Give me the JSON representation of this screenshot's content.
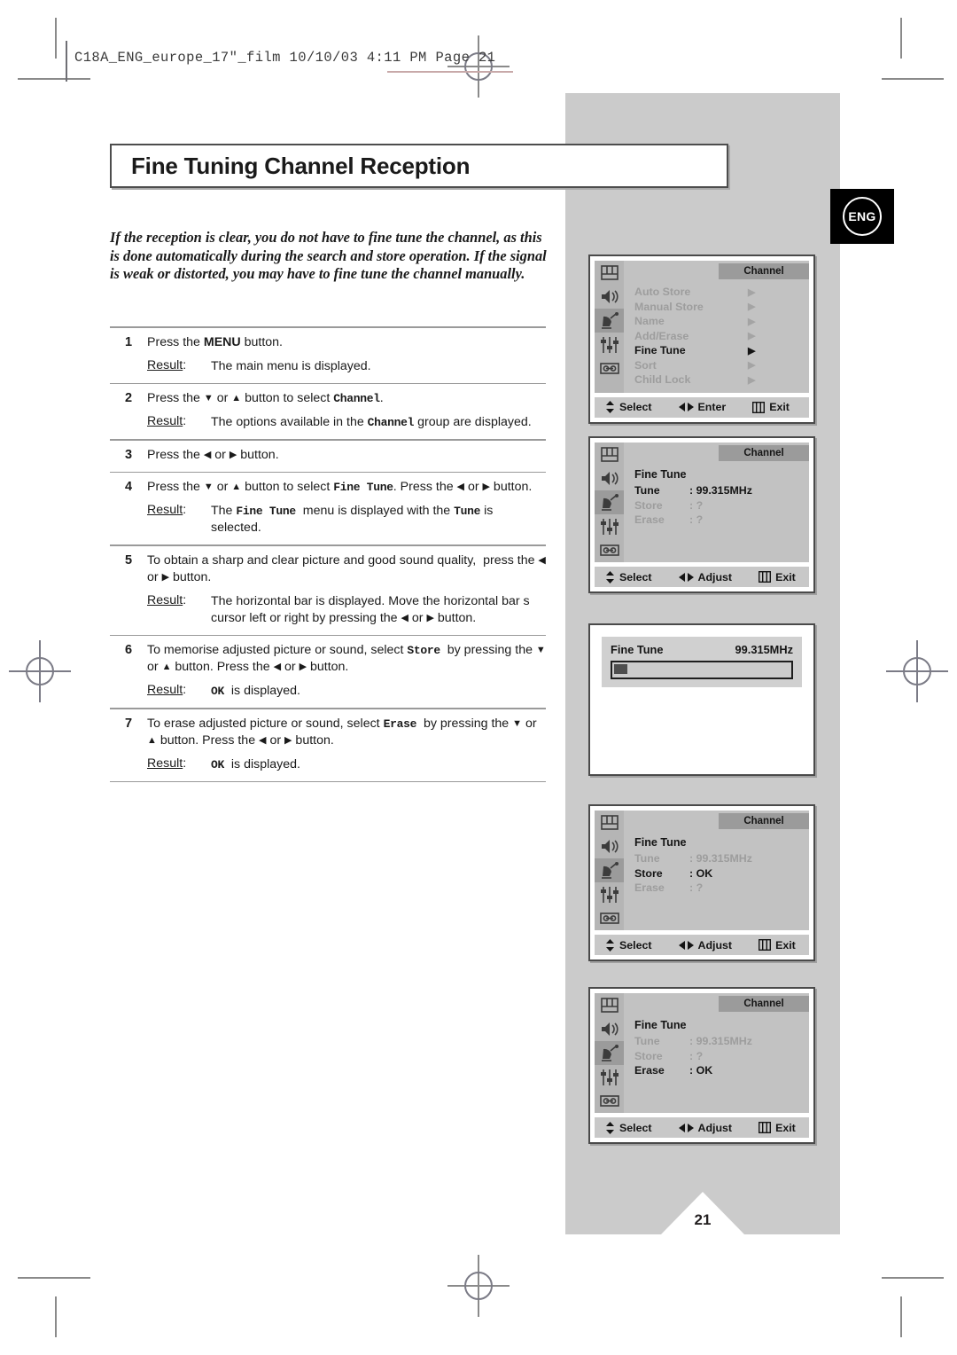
{
  "print_header": {
    "text": "C18A_ENG_europe_17\"_film   10/10/03   4:11 PM   Page 21"
  },
  "language_badge": {
    "label": "ENG"
  },
  "page": {
    "number": "21"
  },
  "title": "Fine Tuning Channel Reception",
  "intro": "If the reception is clear, you do not have to fine tune the channel, as this is done automatically during the search and store operation. If the signal is weak or distorted, you may have to fine tune the channel manually.",
  "steps": [
    {
      "num": "1",
      "instruction_html": "Press the <b>MENU</b> button.",
      "result_label": "Result",
      "result_html": "The main menu is displayed."
    },
    {
      "num": "2",
      "instruction_html": "Press the <span class=\"arr\">▼</span> or <span class=\"arr\">▲</span> button to select <span class=\"mono\">Channel</span>.",
      "result_label": "Result",
      "result_html": "The options available in the <span class=\"mono\">Channel</span> group are displayed."
    },
    {
      "num": "3",
      "instruction_html": "Press the <span class=\"arr\">◀</span> or <span class=\"arr\">▶</span> button.",
      "result_label": "",
      "result_html": ""
    },
    {
      "num": "4",
      "instruction_html": "Press the <span class=\"arr\">▼</span> or <span class=\"arr\">▲</span> button to select <span class=\"mono\">Fine Tune</span>. Press the <span class=\"arr\">◀</span> or <span class=\"arr\">▶</span> button.",
      "result_label": "Result",
      "result_html": "The <span class=\"mono\">Fine Tune</span>&nbsp; menu is displayed with the <span class=\"mono\">Tune</span> is selected."
    },
    {
      "num": "5",
      "instruction_html": "To obtain a sharp and clear picture and good sound quality,&nbsp; press the <span class=\"arr\">◀</span> or <span class=\"arr\">▶</span> button.",
      "result_label": "Result",
      "result_html": "The horizontal bar is displayed. Move the horizontal bar s cursor left or right by pressing the <span class=\"arr\">◀</span> or <span class=\"arr\">▶</span> button."
    },
    {
      "num": "6",
      "instruction_html": "To memorise adjusted picture or sound, select <span class=\"mono\">Store</span>&nbsp; by pressing the <span class=\"arr\">▼</span> or <span class=\"arr\">▲</span> button. Press the <span class=\"arr\">◀</span> or <span class=\"arr\">▶</span> button.",
      "result_label": "Result",
      "result_html": "<span class=\"mono\">OK</span>&nbsp; is displayed."
    },
    {
      "num": "7",
      "instruction_html": "To erase adjusted picture or sound, select <span class=\"mono\">Erase</span>&nbsp; by pressing the <span class=\"arr\">▼</span> or <span class=\"arr\">▲</span> button. Press the <span class=\"arr\">◀</span> or <span class=\"arr\">▶</span> button.",
      "result_label": "Result",
      "result_html": "<span class=\"mono\">OK</span>&nbsp; is displayed."
    }
  ],
  "osd_panels": [
    {
      "id": "channel-menu",
      "title": "Channel",
      "type": "list",
      "active_icon_index": 2,
      "items": [
        {
          "label": "Auto Store",
          "chevron": "▶",
          "active": false
        },
        {
          "label": "Manual Store",
          "chevron": "▶",
          "active": false
        },
        {
          "label": "Name",
          "chevron": "▶",
          "active": false
        },
        {
          "label": "Add/Erase",
          "chevron": "▶",
          "active": false
        },
        {
          "label": "Fine Tune",
          "chevron": "▶",
          "active": true
        },
        {
          "label": "Sort",
          "chevron": "▶",
          "active": false
        },
        {
          "label": "Child Lock",
          "chevron": "▶",
          "active": false
        }
      ],
      "footer": [
        {
          "glyph": "↕",
          "label": "Select"
        },
        {
          "glyph": "◀▶",
          "label": "Enter"
        },
        {
          "glyph": "‖‖",
          "label": "Exit"
        }
      ]
    },
    {
      "id": "fine-tune-tune",
      "title": "Channel",
      "type": "kv",
      "active_icon_index": 2,
      "heading": "Fine Tune",
      "rows": [
        {
          "key": "Tune",
          "value": ": 99.315MHz",
          "active": true
        },
        {
          "key": "Store",
          "value": ": ?",
          "active": false
        },
        {
          "key": "Erase",
          "value": ": ?",
          "active": false
        }
      ],
      "footer": [
        {
          "glyph": "↕",
          "label": "Select"
        },
        {
          "glyph": "◀▶",
          "label": "Adjust"
        },
        {
          "glyph": "‖‖",
          "label": "Exit"
        }
      ]
    },
    {
      "id": "fine-tune-slider",
      "type": "slider",
      "slider_label": "Fine Tune",
      "slider_value": "99.315MHz",
      "slider_percent": 0
    },
    {
      "id": "fine-tune-store",
      "title": "Channel",
      "type": "kv",
      "active_icon_index": 2,
      "heading": "Fine Tune",
      "rows": [
        {
          "key": "Tune",
          "value": ": 99.315MHz",
          "active": false
        },
        {
          "key": "Store",
          "value": ": OK",
          "active": true
        },
        {
          "key": "Erase",
          "value": ": ?",
          "active": false
        }
      ],
      "footer": [
        {
          "glyph": "↕",
          "label": "Select"
        },
        {
          "glyph": "◀▶",
          "label": "Adjust"
        },
        {
          "glyph": "‖‖",
          "label": "Exit"
        }
      ]
    },
    {
      "id": "fine-tune-erase",
      "title": "Channel",
      "type": "kv",
      "active_icon_index": 2,
      "heading": "Fine Tune",
      "rows": [
        {
          "key": "Tune",
          "value": ": 99.315MHz",
          "active": false
        },
        {
          "key": "Store",
          "value": ": ?",
          "active": false
        },
        {
          "key": "Erase",
          "value": ": OK",
          "active": true
        }
      ],
      "footer": [
        {
          "glyph": "↕",
          "label": "Select"
        },
        {
          "glyph": "◀▶",
          "label": "Adjust"
        },
        {
          "glyph": "‖‖",
          "label": "Exit"
        }
      ]
    }
  ],
  "osd_icons": [
    "picture-icon",
    "sound-icon",
    "channel-dish-icon",
    "setup-sliders-icon",
    "feature-icon"
  ],
  "colors": {
    "panel_grey": "#cbcbcb",
    "osd_bg": "#c2c2c2",
    "osd_title_bar": "#9b9b9b",
    "osd_icon_col": "#b5b5b5",
    "osd_disabled_text": "#9d9d9d",
    "text": "#1a1a1a",
    "badge_bg": "#000000"
  }
}
